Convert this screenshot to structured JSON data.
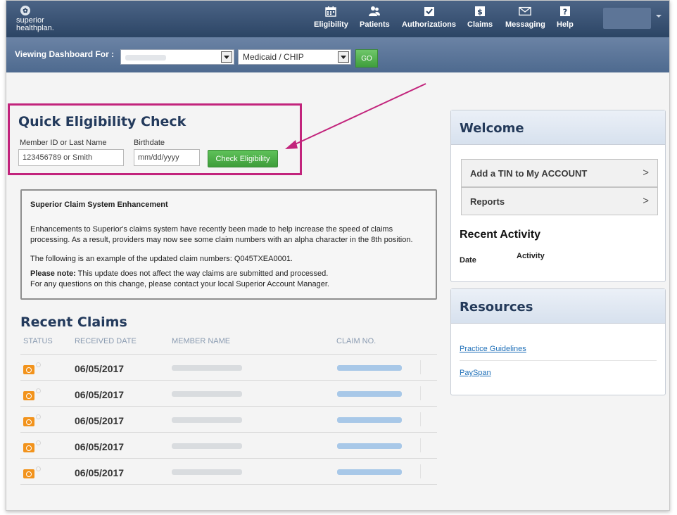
{
  "brand": {
    "line1": "superior",
    "line2": "healthplan."
  },
  "nav": {
    "items": [
      {
        "label": "Eligibility",
        "icon": "calendar-icon"
      },
      {
        "label": "Patients",
        "icon": "people-icon"
      },
      {
        "label": "Authorizations",
        "icon": "checkmark-icon"
      },
      {
        "label": "Claims",
        "icon": "dollar-icon"
      },
      {
        "label": "Messaging",
        "icon": "envelope-icon"
      },
      {
        "label": "Help",
        "icon": "question-icon"
      }
    ]
  },
  "dashboard": {
    "label": "Viewing Dashboard For :",
    "program": "Medicaid / CHIP",
    "go_label": "GO"
  },
  "quick_eligibility": {
    "title": "Quick Eligibility Check",
    "member_label": "Member ID or Last Name",
    "member_placeholder": "123456789 or Smith",
    "birthdate_label": "Birthdate",
    "birthdate_placeholder": "mm/dd/yyyy",
    "button_label": "Check Eligibility"
  },
  "notice": {
    "title": "Superior Claim System Enhancement",
    "p1": "Enhancements to Superior's claims system have recently been made to help increase the speed of claims processing. As a result, providers may now see some claim numbers with an alpha character in the 8th position.",
    "p2": "The following is an example of the updated claim numbers: Q045TXEA0001.",
    "p3_bold": "Please note:",
    "p3": " This update does not affect the way claims are submitted and processed.",
    "p4": "For any questions on this change, please contact your local Superior Account Manager."
  },
  "recent_claims": {
    "title": "Recent Claims",
    "headers": [
      "STATUS",
      "RECEIVED DATE",
      "MEMBER NAME",
      "CLAIM NO."
    ],
    "rows": [
      {
        "date": "06/05/2017"
      },
      {
        "date": "06/05/2017"
      },
      {
        "date": "06/05/2017"
      },
      {
        "date": "06/05/2017"
      },
      {
        "date": "06/05/2017"
      }
    ]
  },
  "welcome": {
    "title": "Welcome",
    "items": [
      {
        "label": "Add a TIN to My ACCOUNT",
        "chevron": ">"
      },
      {
        "label": "Reports",
        "chevron": ">"
      }
    ],
    "recent_activity_title": "Recent Activity",
    "col_date": "Date",
    "col_activity": "Activity"
  },
  "resources": {
    "title": "Resources",
    "links": [
      "Practice Guidelines",
      "PaySpan"
    ]
  },
  "colors": {
    "nav_bg": "#2c4565",
    "accent_green": "#3e9d3a",
    "highlight_magenta": "#c2247c",
    "status_orange": "#f2931c",
    "heading_navy": "#233a5c",
    "link_blue": "#1e6fb8"
  }
}
